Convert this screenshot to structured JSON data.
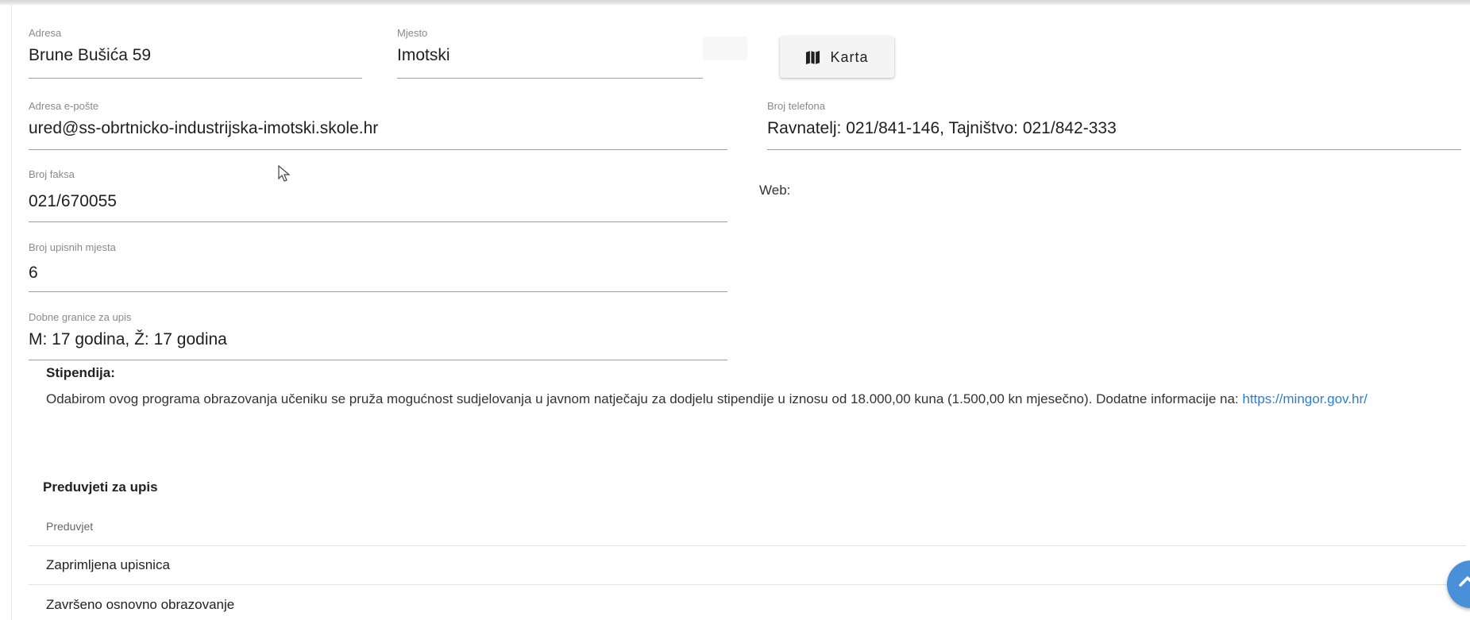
{
  "fields": {
    "adresa": {
      "label": "Adresa",
      "value": "Brune Bušića 59"
    },
    "mjesto": {
      "label": "Mjesto",
      "value": "Imotski"
    },
    "email": {
      "label": "Adresa e-pošte",
      "value": "ured@ss-obrtnicko-industrijska-imotski.skole.hr"
    },
    "telefon": {
      "label": "Broj telefona",
      "value": "Ravnatelj: 021/841-146, Tajništvo: 021/842-333"
    },
    "faks": {
      "label": "Broj faksa",
      "value": "021/670055"
    },
    "upisna_mjesta": {
      "label": "Broj upisnih mjesta",
      "value": "6"
    },
    "dobne_granice": {
      "label": "Dobne granice za upis",
      "value": "M: 17 godina, Ž: 17 godina"
    }
  },
  "karta_button": {
    "label": "Karta",
    "icon": "map-icon"
  },
  "web": {
    "label": "Web:"
  },
  "stipendija": {
    "title": "Stipendija:",
    "text": "Odabirom ovog programa obrazovanja učeniku se pruža mogućnost sudjelovanja u javnom natječaju za dodjelu stipendije u iznosu od 18.000,00 kuna (1.500,00 kn mjesečno). Dodatne informacije na: ",
    "link": "https://mingor.gov.hr/"
  },
  "preduvjeti": {
    "title": "Preduvjeti za upis",
    "column": "Preduvjet",
    "rows": [
      "Zaprimljena upisnica",
      "Završeno osnovno obrazovanje"
    ]
  },
  "fab": {
    "icon": "chevron-up-icon",
    "color": "#4a90d9"
  },
  "colors": {
    "link": "#2a7fd4",
    "label": "#8a8a8a"
  }
}
